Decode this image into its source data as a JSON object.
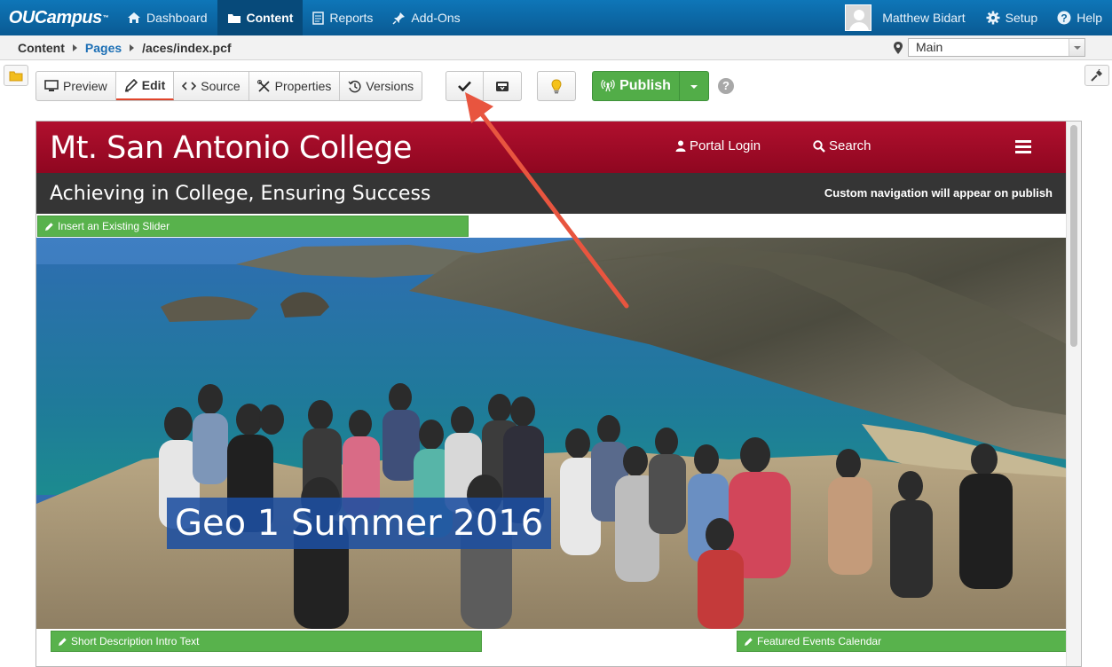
{
  "app": {
    "logo": "OUCampus",
    "nav": [
      {
        "label": "Dashboard",
        "icon": "home-icon"
      },
      {
        "label": "Content",
        "icon": "folder-icon",
        "active": true
      },
      {
        "label": "Reports",
        "icon": "report-icon"
      },
      {
        "label": "Add-Ons",
        "icon": "pin-icon"
      }
    ],
    "user_name": "Matthew Bidart",
    "setup_label": "Setup",
    "help_label": "Help"
  },
  "breadcrumb": {
    "root": "Content",
    "pages": "Pages",
    "path": "/aces/index.pcf"
  },
  "environment": {
    "selected": "Main"
  },
  "toolbar": {
    "view_tabs": [
      {
        "label": "Preview",
        "icon": "monitor-icon"
      },
      {
        "label": "Edit",
        "icon": "pencil-icon",
        "active": true
      },
      {
        "label": "Source",
        "icon": "code-icon"
      },
      {
        "label": "Properties",
        "icon": "wrench-icon"
      },
      {
        "label": "Versions",
        "icon": "history-icon"
      }
    ],
    "publish_label": "Publish"
  },
  "page": {
    "site_title": "Mt. San Antonio College",
    "portal_login": "Portal Login",
    "search": "Search",
    "tagline": "Achieving in College, Ensuring Success",
    "custom_nav_note": "Custom navigation will appear on publish",
    "edit_buttons": {
      "slider": "Insert an Existing Slider",
      "intro": "Short Description Intro Text",
      "events": "Featured Events Calendar"
    },
    "hero_caption": "Geo 1 Summer 2016"
  },
  "colors": {
    "nav_blue": "#0a5a93",
    "brand_red": "#a00c28",
    "publish_green": "#52ad48",
    "arrow_red": "#e8553f"
  }
}
